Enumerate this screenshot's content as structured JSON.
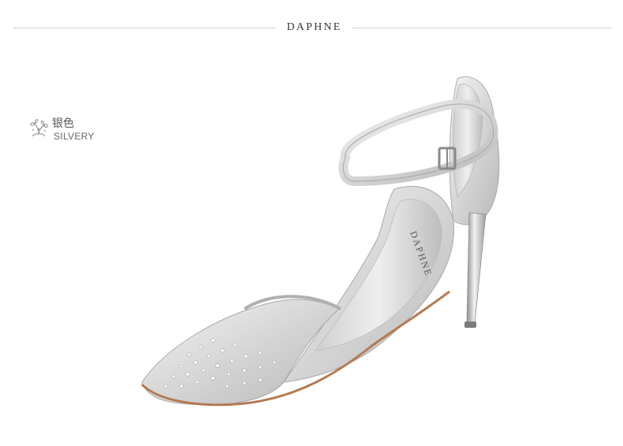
{
  "header": {
    "brand": "DAPHNE"
  },
  "color": {
    "name_cn": "银色",
    "name_en": "SILVERY",
    "icon": "flower-icon"
  },
  "product": {
    "image": "silver-glitter-pointed-heel-with-ankle-strap",
    "insole_brand": "DAPHNE"
  },
  "palette": {
    "silver": "#d8d8d8",
    "silver_dark": "#9a9a9a",
    "background": "#ffffff"
  }
}
